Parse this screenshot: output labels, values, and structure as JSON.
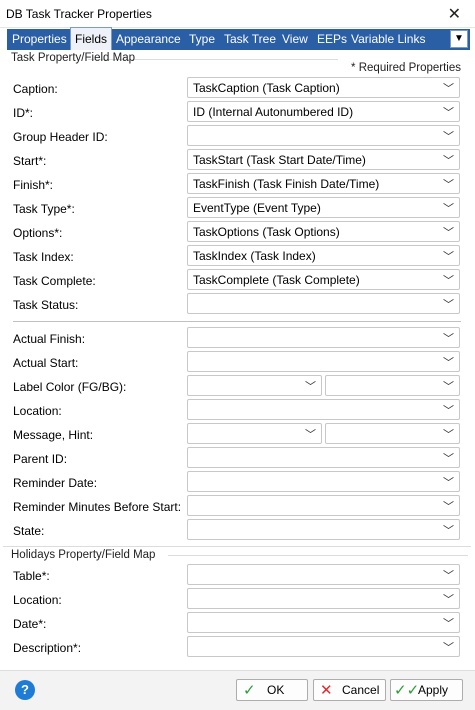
{
  "window": {
    "title": "DB Task Tracker  Properties",
    "close_glyph": "✕"
  },
  "tabs": [
    {
      "label": "Properties",
      "active": false
    },
    {
      "label": "Fields",
      "active": true
    },
    {
      "label": "Appearance",
      "active": false
    },
    {
      "label": "Type",
      "active": false
    },
    {
      "label": "Task Tree",
      "active": false
    },
    {
      "label": "View",
      "active": false
    },
    {
      "label": "EEPs",
      "active": false
    },
    {
      "label": "Variable Links",
      "active": false
    }
  ],
  "task_group": {
    "title": "Task Property/Field Map",
    "required_note": "* Required Properties",
    "fields": [
      {
        "label": "Caption:",
        "value": "TaskCaption  (Task Caption)"
      },
      {
        "label": "ID*:",
        "value": "ID  (Internal Autonumbered ID)"
      },
      {
        "label": "Group Header ID:",
        "value": ""
      },
      {
        "label": "Start*:",
        "value": "TaskStart  (Task Start Date/Time)"
      },
      {
        "label": "Finish*:",
        "value": "TaskFinish  (Task Finish Date/Time)"
      },
      {
        "label": "Task Type*:",
        "value": "EventType  (Event Type)"
      },
      {
        "label": "Options*:",
        "value": "TaskOptions  (Task Options)"
      },
      {
        "label": "Task Index:",
        "value": "TaskIndex  (Task Index)"
      },
      {
        "label": "Task Complete:",
        "value": "TaskComplete  (Task Complete)"
      },
      {
        "label": "Task Status:",
        "value": ""
      }
    ],
    "extra_fields": [
      {
        "label": "Actual Finish:",
        "value": ""
      },
      {
        "label": "Actual Start:",
        "value": ""
      },
      {
        "label": "Label Color (FG/BG):",
        "value": "",
        "value2": ""
      },
      {
        "label": "Location:",
        "value": ""
      },
      {
        "label": "Message, Hint:",
        "value": "",
        "value2": ""
      },
      {
        "label": "Parent ID:",
        "value": ""
      },
      {
        "label": "Reminder Date:",
        "value": ""
      },
      {
        "label": "Reminder Minutes Before Start:",
        "value": ""
      },
      {
        "label": "State:",
        "value": ""
      }
    ]
  },
  "holidays_group": {
    "title": "Holidays Property/Field Map",
    "fields": [
      {
        "label": "Table*:",
        "value": ""
      },
      {
        "label": "Location:",
        "value": ""
      },
      {
        "label": "Date*:",
        "value": ""
      },
      {
        "label": "Description*:",
        "value": ""
      }
    ]
  },
  "footer": {
    "help_glyph": "?",
    "ok_label": "OK",
    "cancel_label": "Cancel",
    "apply_label": "Apply"
  },
  "icons": {
    "dropdown": "chevron-down-icon",
    "ok": "checkmark-icon",
    "cancel": "x-icon",
    "apply": "double-checkmark-icon",
    "help": "question-icon"
  },
  "colors": {
    "tab_bar": "#2a5fa5",
    "ok_check": "#2e9c3a",
    "cancel_x": "#d3302f",
    "help_circle": "#1e7cd6"
  }
}
